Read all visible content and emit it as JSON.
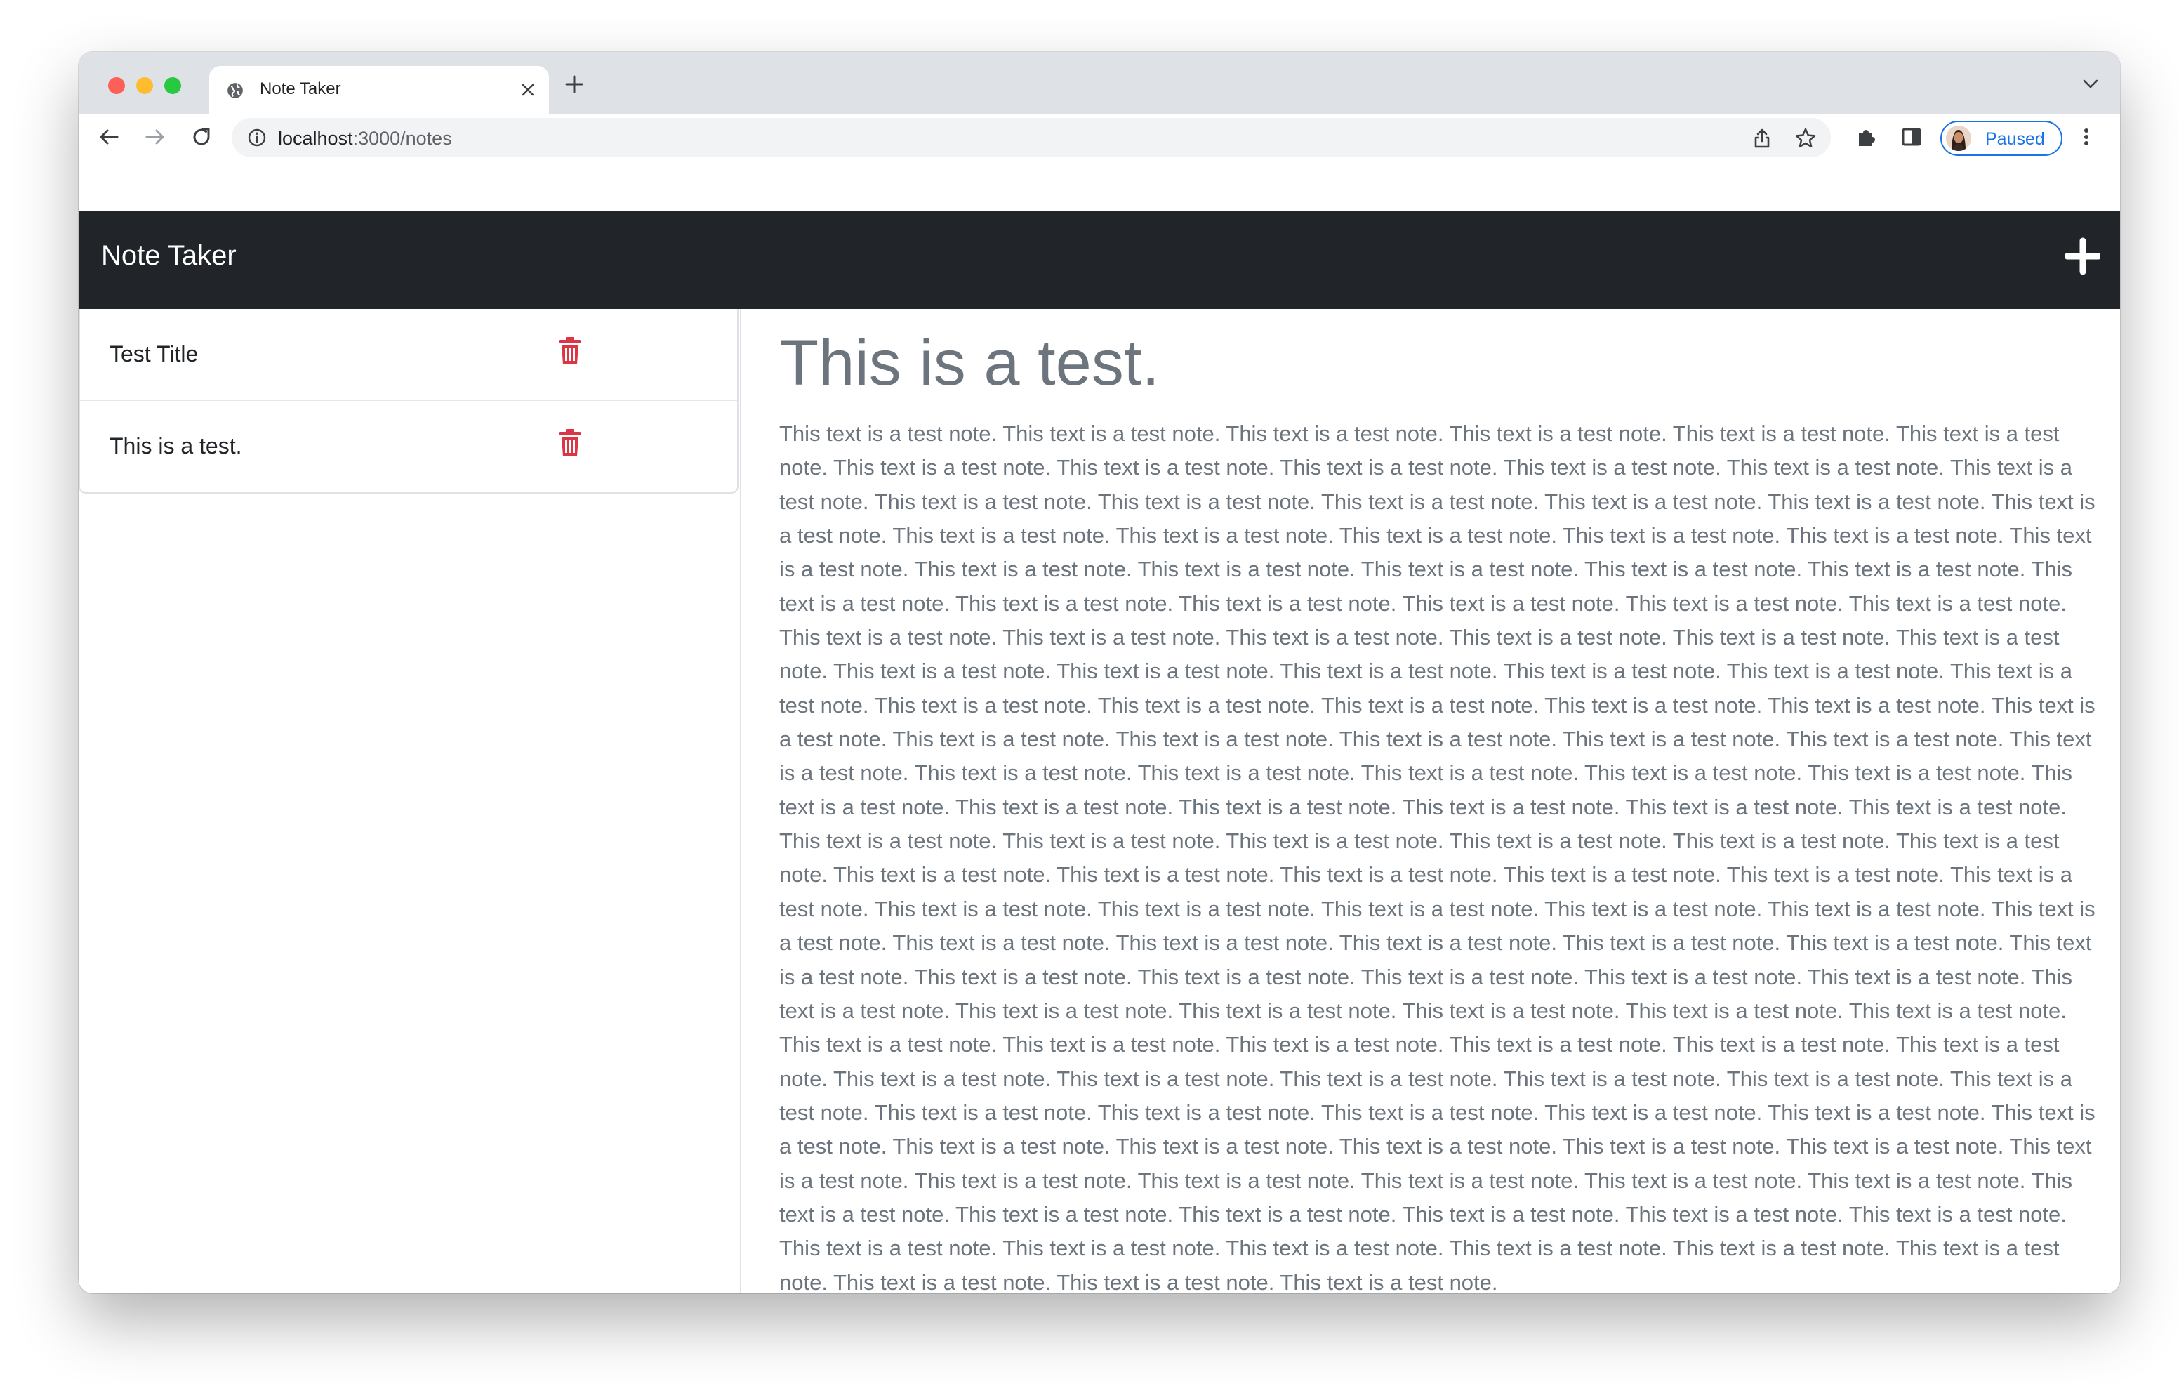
{
  "browser": {
    "tab": {
      "title": "Note Taker",
      "icon": "globe-icon"
    },
    "omnibox": {
      "host": "localhost",
      "path": ":3000/notes"
    },
    "profile": {
      "label": "Paused"
    },
    "colors": {
      "tabstrip": "#dee1e6",
      "accent": "#1a73e8"
    }
  },
  "app": {
    "brand": "Note Taker",
    "new_note_icon": "plus-icon",
    "notes": [
      {
        "title": "Test Title"
      },
      {
        "title": "This is a test."
      }
    ],
    "delete_icon": "trash-icon",
    "active_note": {
      "title": "This is a test.",
      "text": "This text is a test note. This text is a test note. This text is a test note. This text is a test note. This text is a test note. This text is a test note. This text is a test note. This text is a test note. This text is a test note. This text is a test note. This text is a test note. This text is a test note. This text is a test note. This text is a test note. This text is a test note. This text is a test note. This text is a test note. This text is a test note. This text is a test note. This text is a test note. This text is a test note. This text is a test note. This text is a test note. This text is a test note. This text is a test note. This text is a test note. This text is a test note. This text is a test note. This text is a test note. This text is a test note. This text is a test note. This text is a test note. This text is a test note. This text is a test note. This text is a test note. This text is a test note. This text is a test note. This text is a test note. This text is a test note. This text is a test note. This text is a test note. This text is a test note. This text is a test note. This text is a test note. This text is a test note. This text is a test note. This text is a test note. This text is a test note. This text is a test note. This text is a test note. This text is a test note. This text is a test note. This text is a test note. This text is a test note. This text is a test note. This text is a test note. This text is a test note. This text is a test note. This text is a test note. This text is a test note. This text is a test note. This text is a test note. This text is a test note. This text is a test note. This text is a test note. This text is a test note. This text is a test note. This text is a test note. This text is a test note. This text is a test note. This text is a test note. This text is a test note. This text is a test note. This text is a test note. This text is a test note. This text is a test note. This text is a test note. This text is a test note. This text is a test note. This text is a test note. This text is a test note. This text is a test note. This text is a test note. This text is a test note. This text is a test note. This text is a test note. This text is a test note. This text is a test note. This text is a test note. This text is a test note. This text is a test note. This text is a test note. This text is a test note. This text is a test note. This text is a test note. This text is a test note. This text is a test note. This text is a test note. This text is a test note. This text is a test note. This text is a test note. This text is a test note. This text is a test note. This text is a test note. This text is a test note. This text is a test note. This text is a test note. This text is a test note. This text is a test note. This text is a test note. This text is a test note. This text is a test note. This text is a test note. This text is a test note. This text is a test note. This text is a test note. This text is a test note. This text is a test note. This text is a test note. This text is a test note. This text is a test note. This text is a test note. This text is a test note. This text is a test note. This text is a test note. This text is a test note. This text is a test note. This text is a test note. This text is a test note. This text is a test note. This text is a test note. This text is a test note. This text is a test note. This text is a test note. This text is a test note. This text is a test note. This text is a test note. This text is a test note. This text is a test note. This text is a test note. This text is a test note. This text is a test note. This text is a test note. This text is a test note. This text is a test note. This text is a test note. This text is a test note. This text is a test note. This text is a test note."
    },
    "colors": {
      "navbar": "#212529",
      "delete": "#dc3545",
      "muted_text": "#6c757d"
    }
  }
}
